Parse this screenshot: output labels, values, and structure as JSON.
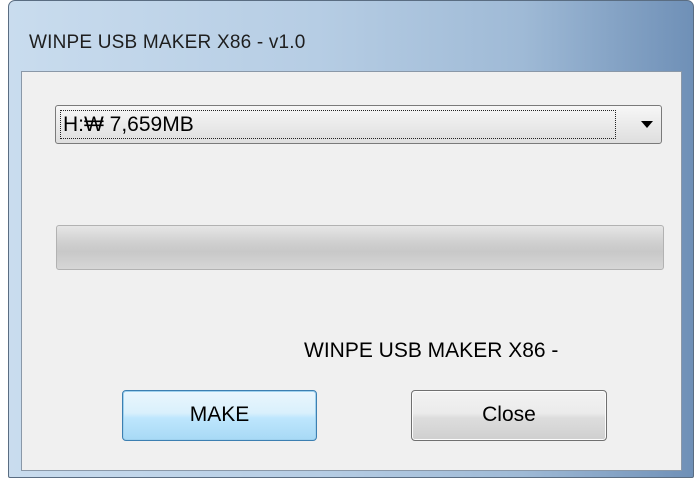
{
  "window": {
    "title": "WINPE USB MAKER X86 - v1.0"
  },
  "drive_select": {
    "selected_value": "H:₩ 7,659MB"
  },
  "progress": {
    "value_percent": 0
  },
  "status": {
    "text": "WINPE USB MAKER X86 -"
  },
  "buttons": {
    "make_label": "MAKE",
    "close_label": "Close"
  },
  "icons": {
    "dropdown": "chevron-down-icon"
  }
}
